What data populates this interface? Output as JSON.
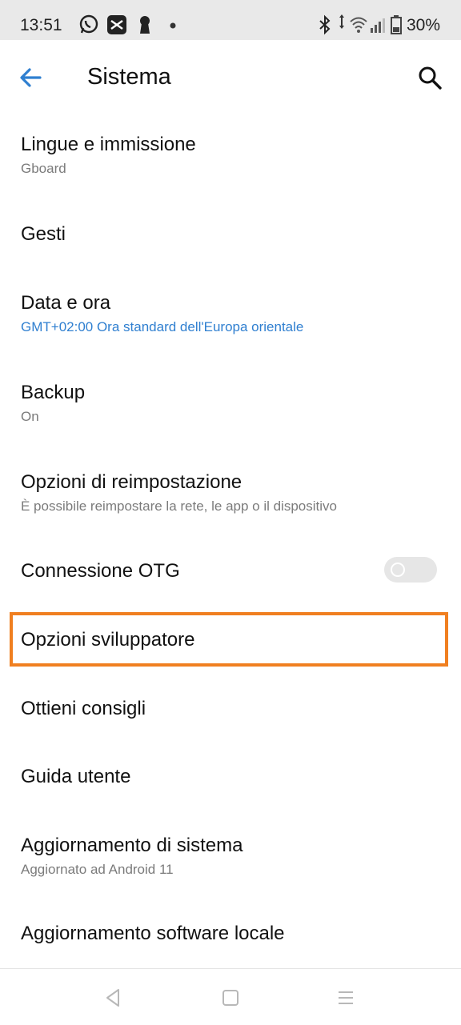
{
  "status_bar": {
    "time": "13:51",
    "battery_percent": "30%",
    "icons": [
      "whatsapp-icon",
      "capcut-icon",
      "keyhole-icon",
      "dot-icon",
      "bluetooth-icon",
      "data-arrows-icon",
      "wifi-icon",
      "signal-icon",
      "battery-icon"
    ]
  },
  "app_bar": {
    "title": "Sistema",
    "back_icon": "arrow-back-icon",
    "search_icon": "search-icon"
  },
  "items": [
    {
      "title": "Lingue e immissione",
      "subtitle": "Gboard"
    },
    {
      "title": "Gesti",
      "subtitle": ""
    },
    {
      "title": "Data e ora",
      "subtitle": "GMT+02:00 Ora standard dell'Europa orientale"
    },
    {
      "title": "Backup",
      "subtitle": "On"
    },
    {
      "title": "Opzioni di reimpostazione",
      "subtitle": "È possibile reimpostare la rete, le app o il dispositivo"
    },
    {
      "title": "Connessione OTG",
      "subtitle": "",
      "toggle": false
    },
    {
      "title": "Opzioni sviluppatore",
      "subtitle": "",
      "highlighted": true
    },
    {
      "title": "Ottieni consigli",
      "subtitle": ""
    },
    {
      "title": "Guida utente",
      "subtitle": ""
    },
    {
      "title": "Aggiornamento di sistema",
      "subtitle": "Aggiornato ad Android 11"
    },
    {
      "title": "Aggiornamento software locale",
      "subtitle": ""
    }
  ],
  "nav_bar": {
    "icons": [
      "nav-back-icon",
      "nav-home-icon",
      "nav-menu-icon"
    ]
  },
  "colors": {
    "accent": "#2f7fd0",
    "highlight": "#f07f20",
    "status_bar_bg": "#e9e9e9"
  }
}
